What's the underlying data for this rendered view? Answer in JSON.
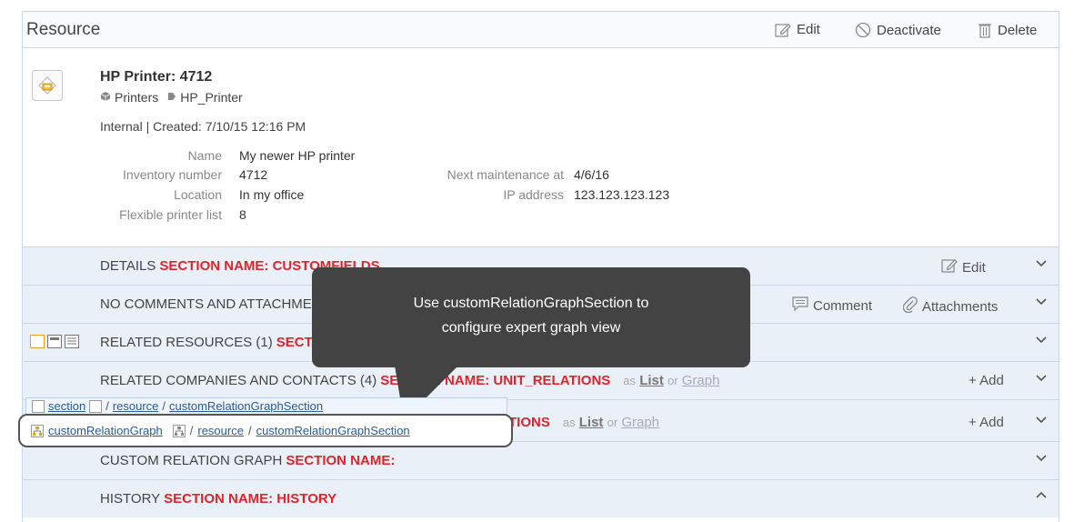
{
  "header": {
    "title": "Resource",
    "edit_label": "Edit",
    "deactivate_label": "Deactivate",
    "delete_label": "Delete"
  },
  "resource": {
    "title": "HP Printer: 4712",
    "category": "Printers",
    "type": "HP_Printer",
    "meta": "Internal | Created: 7/10/15 12:16 PM"
  },
  "fields": {
    "name_label": "Name",
    "name_value": "My newer HP printer",
    "inventory_label": "Inventory number",
    "inventory_value": "4712",
    "location_label": "Location",
    "location_value": "In my office",
    "flexible_label": "Flexible printer list",
    "flexible_value": "8",
    "maintenance_label": "Next maintenance at",
    "maintenance_value": "4/6/16",
    "ip_label": "IP address",
    "ip_value": "123.123.123.123"
  },
  "sections": {
    "details": {
      "title": "DETAILS",
      "section_name": "SECTION NAME: CUSTOMFIELDS",
      "edit_label": "Edit"
    },
    "comments": {
      "title": "NO COMMENTS AND ATTACHMENTS",
      "comment_label": "Comment",
      "attachments_label": "Attachments"
    },
    "related_resources": {
      "title": "RELATED RESOURCES (1)",
      "section_name": "SECTION NAME:"
    },
    "related_companies": {
      "title": "RELATED COMPANIES AND CONTACTS (4)",
      "section_name": "SECTION NAME: UNIT_RELATIONS",
      "as_text": "as",
      "list_label": "List",
      "or_text": "or",
      "graph_label": "Graph",
      "add_label": "+ Add"
    },
    "related_tickets": {
      "section_name": "TIONS",
      "as_text": "as",
      "list_label": "List",
      "or_text": "or",
      "graph_label": "Graph",
      "add_label": "+ Add"
    },
    "custom_graph": {
      "title": "CUSTOM RELATION GRAPH",
      "section_name": "SECTION NAME:"
    },
    "history": {
      "title": "HISTORY",
      "section_name": "SECTION NAME: HISTORY"
    }
  },
  "callout": {
    "line1": "Use customRelationGraphSection to",
    "line2": "configure expert graph view"
  },
  "breadcrumb_overlay": {
    "part1": "section",
    "sep1": "/",
    "part2": "resource",
    "sep2": "/",
    "part3": "customRelationGraphSection"
  },
  "breadcrumb_main": {
    "part1": "customRelationGraph",
    "sep1": "/",
    "part2": "resource",
    "sep2": "/",
    "part3": "customRelationGraphSection"
  },
  "colors": {
    "section_bg": "#e9f0f8",
    "section_name_red": "#e2242a",
    "callout_bg": "#434343",
    "border": "#c8d8e8"
  }
}
